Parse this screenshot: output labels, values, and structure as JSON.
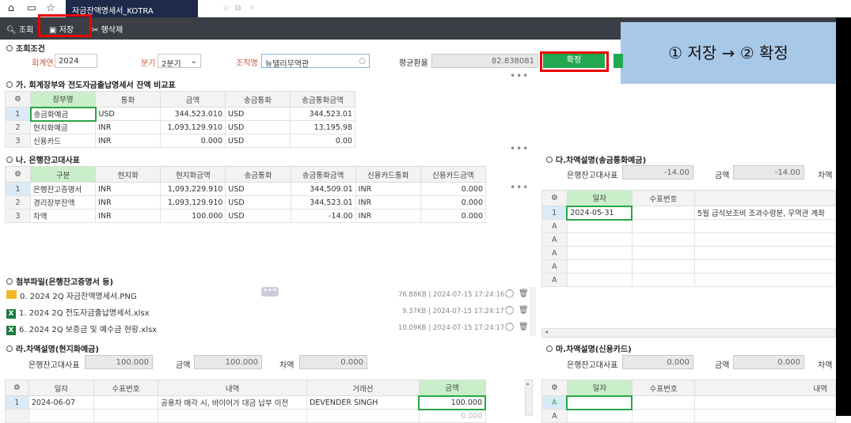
{
  "topbar": {
    "tab_title": "자금잔액명세서_KOTRA"
  },
  "toolbar": {
    "query": "조회",
    "save": "저장",
    "delete_row": "행삭제"
  },
  "callout": "① 저장 → ② 확정",
  "conditions": {
    "title": "조회조건",
    "year_label": "회계연도",
    "year": "2024",
    "quarter_label": "분기",
    "quarter": "2분기",
    "org_label": "조직명",
    "org": "뉴델리무역관",
    "rate_label": "평균환율",
    "rate": "82.838081",
    "confirm_label": "확정"
  },
  "sec_ga": {
    "title": "가. 회계장부와 전도자금출납명세서 잔액 비교표",
    "headers": [
      "장부명",
      "통화",
      "금액",
      "송금통화",
      "송금통화금액"
    ],
    "rows": [
      [
        "1",
        "송금화예금",
        "USD",
        "344,523.010",
        "USD",
        "344,523.01"
      ],
      [
        "2",
        "현지화예금",
        "INR",
        "1,093,129.910",
        "USD",
        "13,195.98"
      ],
      [
        "3",
        "신용카드",
        "INR",
        "0.000",
        "USD",
        "0.00"
      ]
    ]
  },
  "sec_na": {
    "title": "나. 은행잔고대사표",
    "headers": [
      "구분",
      "현지화",
      "현지화금액",
      "송금통화",
      "송금통화금액",
      "신용카드통화",
      "신용카드금액"
    ],
    "rows": [
      [
        "1",
        "은행잔고증명서",
        "INR",
        "1,093,229.910",
        "USD",
        "344,509.01",
        "INR",
        "0.000"
      ],
      [
        "2",
        "경리장부잔액",
        "INR",
        "1,093,129.910",
        "USD",
        "344,523.01",
        "INR",
        "0.000"
      ],
      [
        "3",
        "차액",
        "INR",
        "100.000",
        "USD",
        "-14.00",
        "INR",
        "0.000"
      ]
    ]
  },
  "sec_da": {
    "title": "다.차액설명(송금통화예금)",
    "bank_label": "은행잔고대사표",
    "bank_val": "-14.00",
    "amt_label": "금액",
    "amt_val": "-14.00",
    "diff_label": "차액",
    "headers": [
      "일자",
      "수표번호"
    ],
    "row1_date": "2024-05-31",
    "row1_desc": "5월 급식보조비 조과수령분, 무역관 계좌",
    "rowA": "A"
  },
  "files": {
    "title": "첨부파일(은행잔고증명서 등)",
    "items": [
      {
        "name": "0. 2024 2Q 자금잔액명세서.PNG",
        "size": "76.88KB",
        "date": "2024-07-15 17:24:16"
      },
      {
        "name": "1. 2024 2Q 전도자금출납명세서.xlsx",
        "size": "9.37KB",
        "date": "2024-07-15 17:24:17"
      },
      {
        "name": "6. 2024 2Q 보증금 및 예수금 현황.xlsx",
        "size": "10.09KB",
        "date": "2024-07-15 17:24:17"
      }
    ]
  },
  "sec_ra": {
    "title": "라.차액설명(현지화예금)",
    "bank_label": "은행잔고대사표",
    "bank_val": "100.000",
    "amt_label": "금액",
    "amt_val": "100.000",
    "diff_label": "차액",
    "diff_val": "0.000",
    "headers": [
      "일자",
      "수표번호",
      "내역",
      "거래선",
      "금액"
    ],
    "row1": [
      "1",
      "2024-06-07",
      "",
      "공용차 매각 시, 바이어가 대금 납부 이전",
      "DEVENDER SINGH",
      "100.000"
    ],
    "row2_amt": "0.000"
  },
  "sec_ma": {
    "title": "마.차액설명(신용카드)",
    "bank_label": "은행잔고대사표",
    "bank_val": "0.000",
    "amt_label": "금액",
    "amt_val": "0.000",
    "diff_label": "차액",
    "headers": [
      "일자",
      "수표번호",
      "내역"
    ],
    "rowA": "A"
  }
}
